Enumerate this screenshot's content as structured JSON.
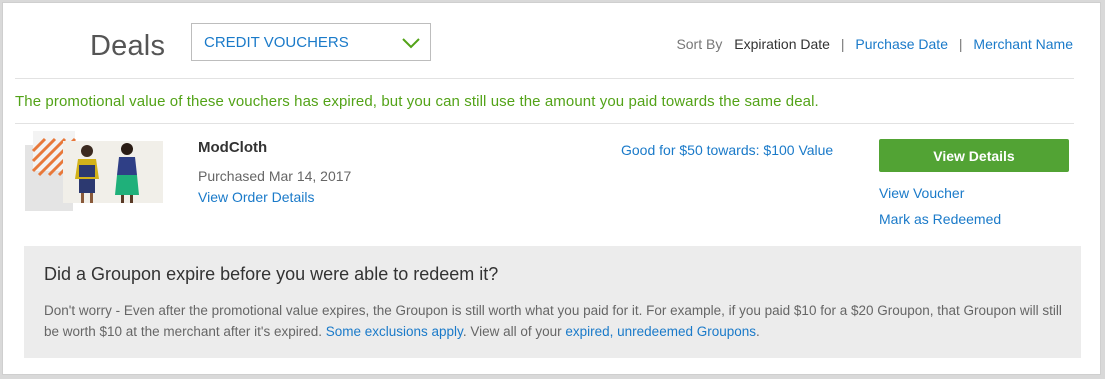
{
  "page": {
    "title": "Deals",
    "filter": {
      "selected": "CREDIT VOUCHERS",
      "icon": "chevron-down-icon"
    },
    "sort": {
      "label": "Sort By",
      "active": "Expiration Date",
      "options": [
        "Purchase Date",
        "Merchant Name"
      ],
      "separator": "|"
    }
  },
  "notice": "The promotional value of these vouchers has expired, but you can still use the amount you paid towards the same deal.",
  "deal": {
    "merchant": "ModCloth",
    "purchased": "Purchased Mar 14, 2017",
    "order_link": "View Order Details",
    "value_text": "Good for $50 towards: $100 Value",
    "details_button": "View Details",
    "voucher_link": "View Voucher",
    "redeem_link": "Mark as Redeemed"
  },
  "info": {
    "heading": "Did a Groupon expire before you were able to redeem it?",
    "body_1": "Don't worry - Even after the promotional value expires, the Groupon is still worth what you paid for it. For example, if you paid $10 for a $20 Groupon, that Groupon will still be worth $10 at the merchant after it's expired. ",
    "exclusions_link": "Some exclusions apply",
    "body_2": ". View all of your ",
    "expired_link": "expired, unredeemed Groupons",
    "body_3": "."
  },
  "colors": {
    "accent": "#1a7ac9",
    "notice_green": "#53a318",
    "button_green": "#52a334",
    "panel_bg": "#ececec"
  }
}
